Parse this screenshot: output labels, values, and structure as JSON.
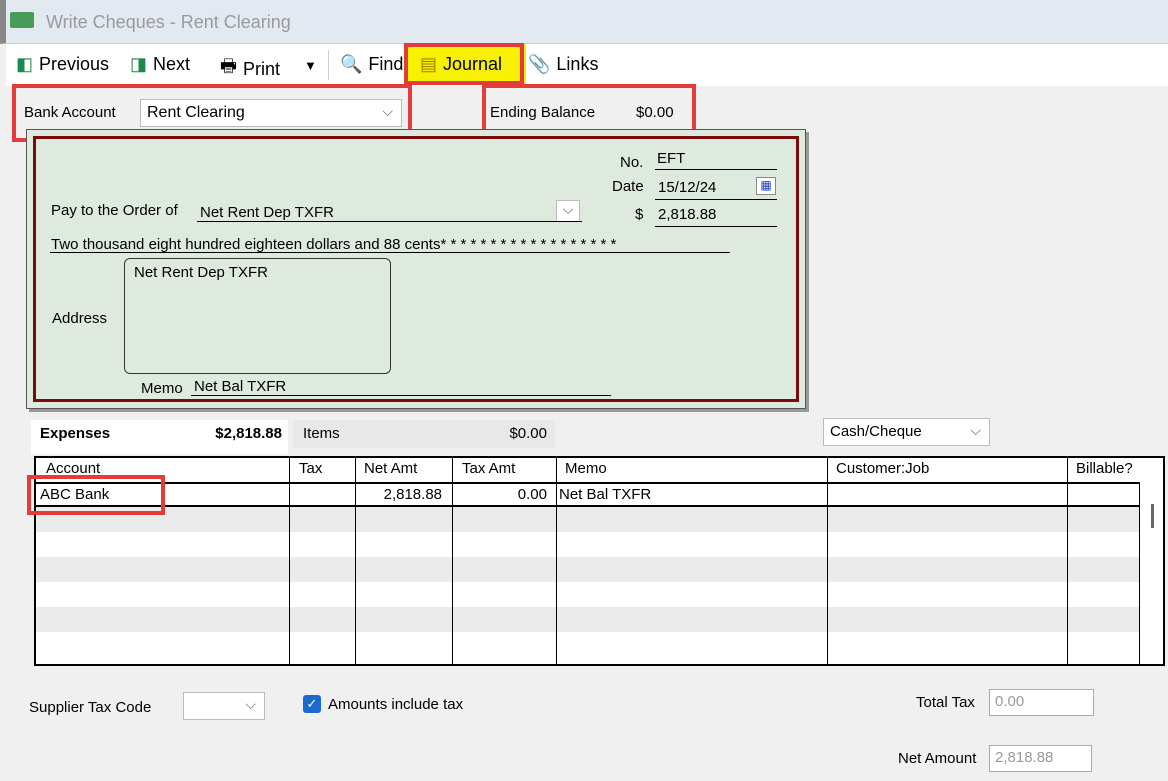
{
  "window": {
    "title": "Write Cheques - Rent Clearing"
  },
  "toolbar": {
    "previous": "Previous",
    "next": "Next",
    "print": "Print",
    "find": "Find",
    "journal": "Journal",
    "links": "Links"
  },
  "header": {
    "bank_account_label": "Bank Account",
    "bank_account": "Rent Clearing",
    "ending_balance_label": "Ending Balance",
    "ending_balance": "$0.00"
  },
  "cheque": {
    "no_label": "No.",
    "no": "EFT",
    "date_label": "Date",
    "date": "15/12/24",
    "amount_label": "$",
    "amount": "2,818.88",
    "pay_to_label": "Pay to the Order of",
    "pay_to": "Net Rent Dep TXFR",
    "amount_words": "Two thousand eight hundred eighteen dollars and 88 cents* * * * * * * * * * * * * * * * * *",
    "address_label": "Address",
    "address": "Net Rent Dep TXFR",
    "memo_label": "Memo",
    "memo": "Net Bal TXFR"
  },
  "tabs": {
    "expenses_label": "Expenses",
    "expenses_total": "$2,818.88",
    "items_label": "Items",
    "items_total": "$0.00",
    "payment_method": "Cash/Cheque"
  },
  "table": {
    "columns": [
      "Account",
      "Tax",
      "Net Amt",
      "Tax Amt",
      "Memo",
      "Customer:Job",
      "Billable?"
    ],
    "rows": [
      {
        "account": "ABC Bank",
        "tax": "",
        "net_amt": "2,818.88",
        "tax_amt": "0.00",
        "memo": "Net Bal TXFR",
        "customer_job": "",
        "billable": ""
      }
    ]
  },
  "footer": {
    "supplier_tax_code_label": "Supplier Tax Code",
    "amounts_include_tax": "Amounts include tax",
    "total_tax_label": "Total Tax",
    "total_tax": "0.00",
    "net_amount_label": "Net Amount",
    "net_amount": "2,818.88"
  }
}
